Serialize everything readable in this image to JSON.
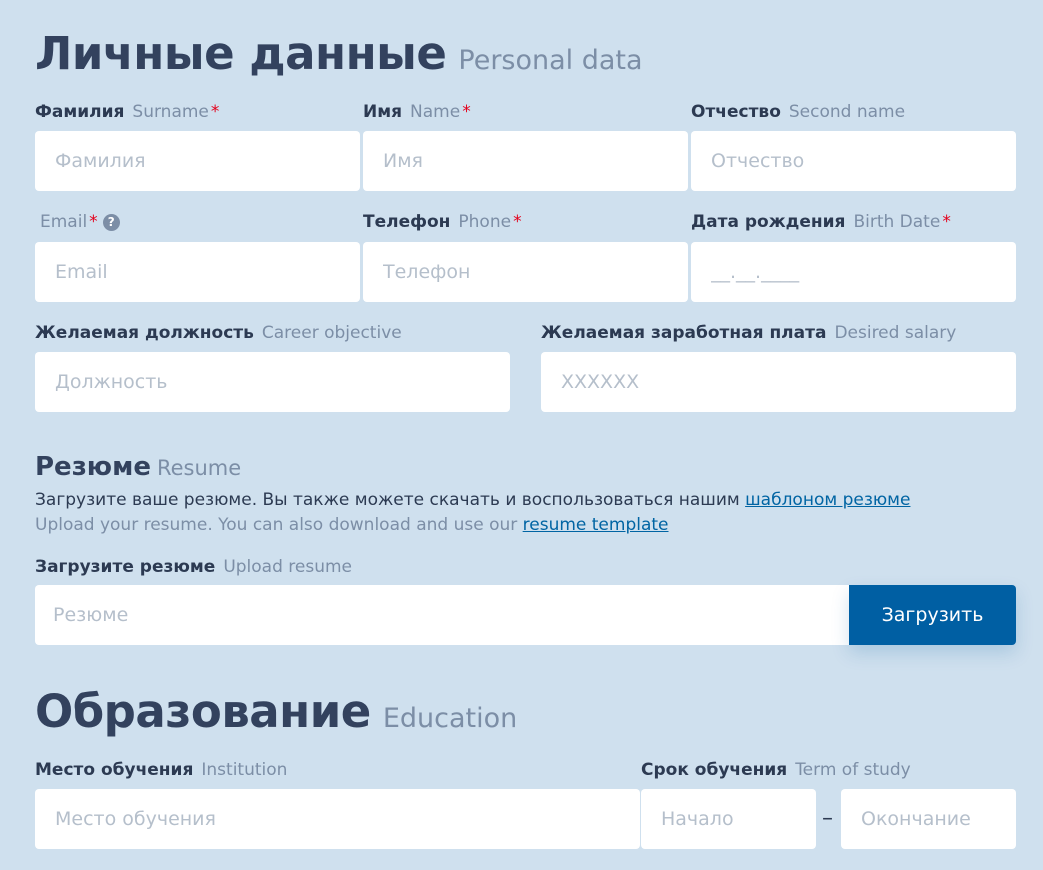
{
  "personal": {
    "title": "Личные данные",
    "title_en": "Personal data",
    "surname": {
      "label": "Фамилия",
      "label_en": "Surname",
      "required": "*",
      "placeholder": "Фамилия"
    },
    "name": {
      "label": "Имя",
      "label_en": "Name",
      "required": "*",
      "placeholder": "Имя"
    },
    "second_name": {
      "label": "Отчество",
      "label_en": "Second name",
      "placeholder": "Отчество"
    },
    "email": {
      "label": "Email",
      "required": "*",
      "help": "?",
      "placeholder": "Email"
    },
    "phone": {
      "label": "Телефон",
      "label_en": "Phone",
      "required": "*",
      "placeholder": "Телефон"
    },
    "birth": {
      "label": "Дата рождения",
      "label_en": "Birth Date",
      "required": "*",
      "placeholder": "__.__.____"
    },
    "career": {
      "label": "Желаемая должность",
      "label_en": "Career objective",
      "placeholder": "Должность"
    },
    "salary": {
      "label": "Желаемая заработная плата",
      "label_en": "Desired salary",
      "placeholder": "XXXXXX"
    }
  },
  "resume": {
    "title": "Резюме",
    "title_en": "Resume",
    "desc_ru": "Загрузите ваше резюме. Вы также можете скачать и воспользоваться нашим ",
    "link_ru": "шаблоном резюме",
    "desc_en": "Upload your resume. You can also download and use our ",
    "link_en": "resume template",
    "upload_label": "Загрузите резюме",
    "upload_label_en": "Upload resume",
    "placeholder": "Резюме",
    "button": "Загрузить"
  },
  "education": {
    "title": "Образование",
    "title_en": "Education",
    "institution": {
      "label": "Место обучения",
      "label_en": "Institution",
      "placeholder": "Место обучения"
    },
    "term": {
      "label": "Срок обучения",
      "label_en": "Term of study",
      "start_placeholder": "Начало",
      "end_placeholder": "Окончание",
      "separator": "–"
    }
  }
}
